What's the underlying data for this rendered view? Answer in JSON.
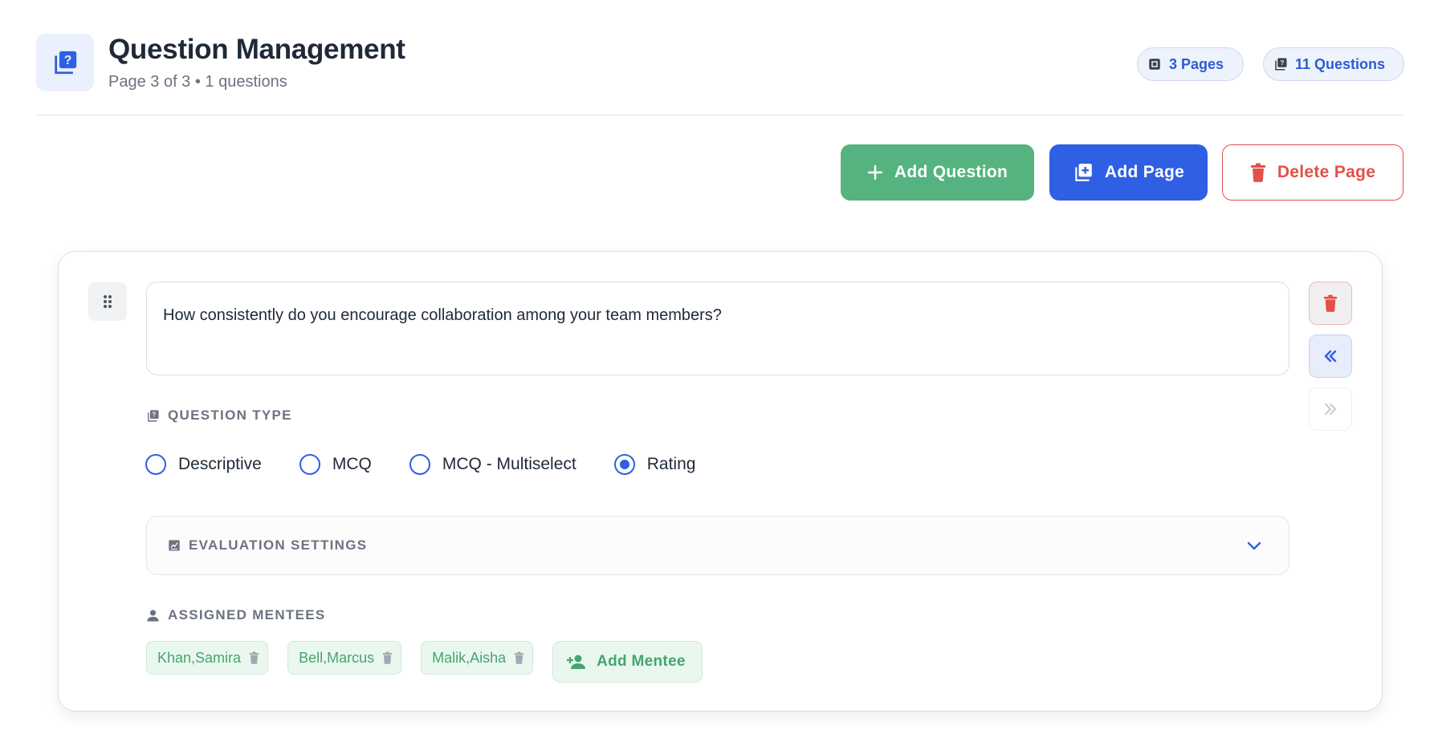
{
  "header": {
    "title": "Question Management",
    "subtitle": "Page 3 of 3 • 1 questions",
    "pages_pill": "3 Pages",
    "questions_pill": "11 Questions"
  },
  "actions": {
    "add_question": "Add Question",
    "add_page": "Add Page",
    "delete_page": "Delete Page"
  },
  "question": {
    "text": "How consistently do you encourage collaboration among your team members?",
    "type_label": "QUESTION TYPE",
    "types": [
      {
        "label": "Descriptive",
        "selected": false
      },
      {
        "label": "MCQ",
        "selected": false
      },
      {
        "label": "MCQ - Multiselect",
        "selected": false
      },
      {
        "label": "Rating",
        "selected": true
      }
    ],
    "evaluation_label": "EVALUATION SETTINGS",
    "mentees_label": "ASSIGNED MENTEES",
    "mentees": [
      "Khan,Samira",
      "Bell,Marcus",
      "Malik,Aisha"
    ],
    "add_mentee": "Add Mentee"
  },
  "colors": {
    "primary": "#2f5fe2",
    "success": "#55b37f",
    "danger": "#e25049"
  }
}
